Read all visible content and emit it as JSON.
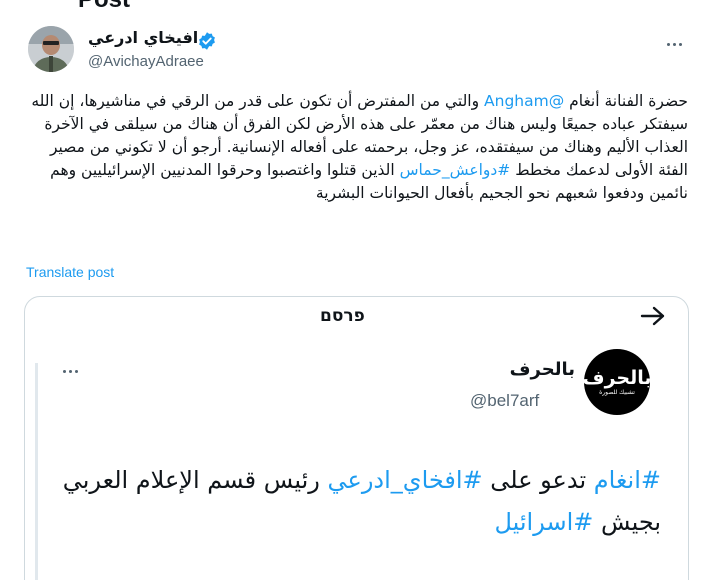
{
  "top": {
    "ghost_title": "Post"
  },
  "post": {
    "author_name": "افيخاي ادرعي",
    "author_handle": "@AvichayAdraee",
    "text_parts": [
      "حضرة الفنانة أنغام ",
      "@Angham",
      " والتي من المفترض أن تكون على قدر من الرقي في مناشيرها، إن الله سيفتكر عباده جميعًا وليس هناك من معمّر على هذه الأرض لكن الفرق أن هناك من سيلقى في الآخرة العذاب الأليم وهناك من سيفتقده، عز وجل، برحمته على أفعاله الإنسانية. أرجو أن لا تكوني من مصير الفئة الأولى لدعمك مخطط ",
      "#دواعش_حماس",
      " الذين قتلوا واغتصبوا وحرقوا المدنيين الإسرائيليين وهم نائمين ودفعوا شعبهم نحو الجحيم بأفعال الحيوانات البشرية"
    ],
    "translate_label": "Translate post"
  },
  "card": {
    "title": "פרסם",
    "quoted": {
      "avatar_logo": "بالحرف",
      "avatar_sub": "تشبيك للصورة",
      "name": "بالحرف",
      "handle": "@bel7arf",
      "text_parts": [
        "#انغام",
        " تدعو على ",
        "#افخاي_ادرعي",
        " رئيس قسم الإعلام العربي بجيش ",
        "#اسرائيل"
      ]
    }
  },
  "colors": {
    "link": "#1d9bf0",
    "muted": "#536471",
    "verified": "#1d9bf0",
    "border": "#cfd9de"
  },
  "icons": {
    "verified": "verified-badge-icon",
    "more": "more-icon",
    "back": "arrow-icon"
  }
}
